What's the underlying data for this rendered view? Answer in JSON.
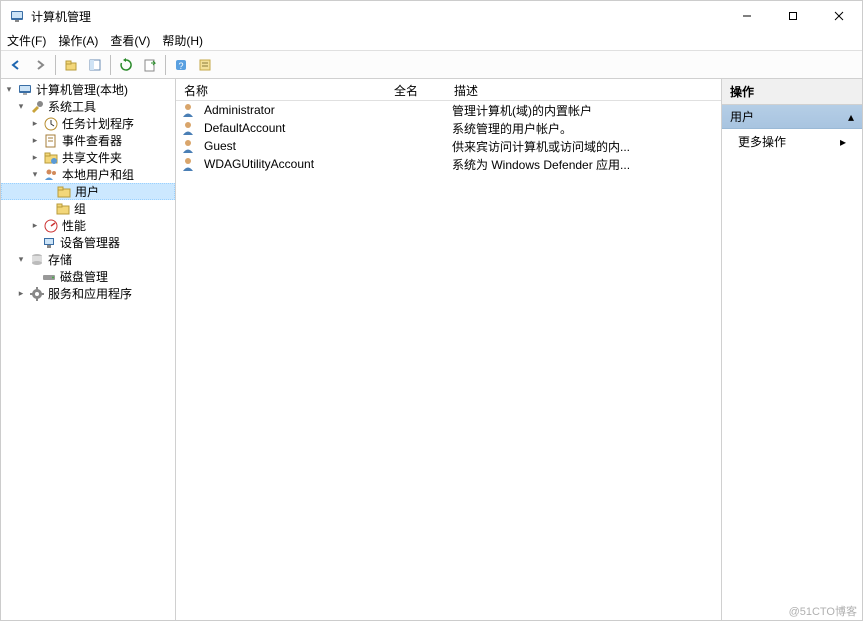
{
  "window": {
    "title": "计算机管理"
  },
  "menu": {
    "file": "文件(F)",
    "action": "操作(A)",
    "view": "查看(V)",
    "help": "帮助(H)"
  },
  "tree": {
    "root": "计算机管理(本地)",
    "system_tools": "系统工具",
    "task_scheduler": "任务计划程序",
    "event_viewer": "事件查看器",
    "shared_folders": "共享文件夹",
    "local_users_groups": "本地用户和组",
    "users": "用户",
    "groups": "组",
    "performance": "性能",
    "device_manager": "设备管理器",
    "storage": "存储",
    "disk_management": "磁盘管理",
    "services_apps": "服务和应用程序"
  },
  "list": {
    "columns": {
      "name": "名称",
      "fullname": "全名",
      "description": "描述"
    },
    "rows": [
      {
        "name": "Administrator",
        "fullname": "",
        "description": "管理计算机(域)的内置帐户"
      },
      {
        "name": "DefaultAccount",
        "fullname": "",
        "description": "系统管理的用户帐户。"
      },
      {
        "name": "Guest",
        "fullname": "",
        "description": "供来宾访问计算机或访问域的内..."
      },
      {
        "name": "WDAGUtilityAccount",
        "fullname": "",
        "description": "系统为 Windows Defender 应用..."
      }
    ]
  },
  "actions": {
    "header": "操作",
    "group": "用户",
    "more": "更多操作"
  },
  "watermark": "@51CTO博客"
}
